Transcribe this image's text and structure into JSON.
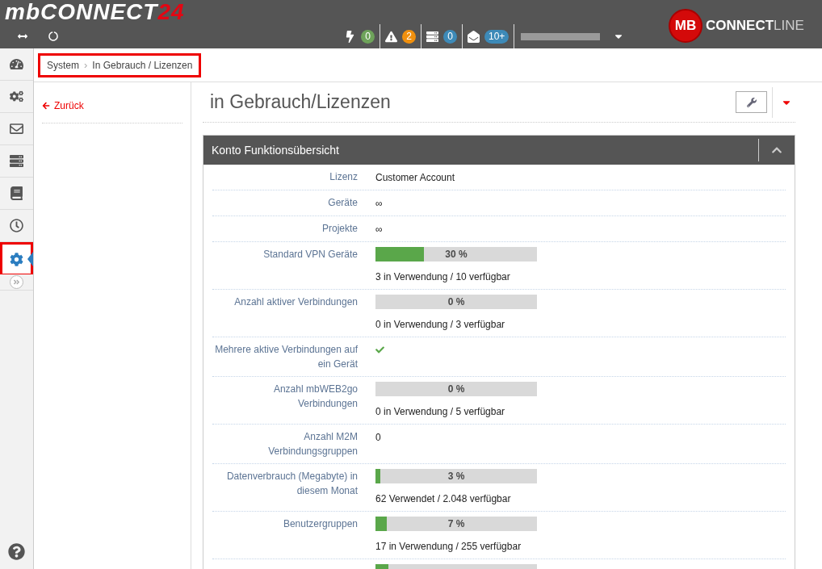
{
  "header": {
    "logo": {
      "main": "mbCONNECT",
      "accent": "24"
    },
    "brand": {
      "badge": "MB",
      "bold": "CONNECT",
      "light": "LINE"
    },
    "notifications": [
      {
        "kind": "bolt",
        "count": "0",
        "color": "#6ea35a"
      },
      {
        "kind": "warning",
        "count": "2",
        "color": "#f0900e"
      },
      {
        "kind": "server",
        "count": "0",
        "color": "#3d8ab8"
      },
      {
        "kind": "mail",
        "count": "10+",
        "color": "#3d8ab8"
      }
    ]
  },
  "breadcrumb": {
    "highlighted": true,
    "separator": "›",
    "items": [
      "System",
      "In Gebrauch / Lizenzen"
    ]
  },
  "sidebar": {
    "items": [
      {
        "kind": "gauge",
        "selected": false
      },
      {
        "kind": "cogs",
        "selected": false
      },
      {
        "kind": "mail",
        "selected": false
      },
      {
        "kind": "server",
        "selected": false
      },
      {
        "kind": "book",
        "selected": false
      },
      {
        "kind": "clock",
        "selected": false
      },
      {
        "kind": "settings",
        "selected": true
      }
    ]
  },
  "back_link": "Zurück",
  "page_title": "in Gebrauch/Lizenzen",
  "panel": {
    "title": "Konto Funktionsübersicht",
    "expanded": true,
    "rows": [
      {
        "kind": "text",
        "label": "Lizenz",
        "value": "Customer Account"
      },
      {
        "kind": "text",
        "label": "Geräte",
        "value": "∞"
      },
      {
        "kind": "text",
        "label": "Projekte",
        "value": "∞"
      },
      {
        "kind": "progress",
        "label": "Standard VPN Geräte",
        "level": 0.3,
        "percent": "30 %",
        "detail": "3 in Verwendung / 10 verfügbar"
      },
      {
        "kind": "progress",
        "label": "Anzahl aktiver Verbindungen",
        "level": 0,
        "percent": "0 %",
        "detail": "0 in Verwendung / 3 verfügbar"
      },
      {
        "kind": "check",
        "label": "Mehrere aktive Verbindungen auf ein Gerät",
        "checked": true
      },
      {
        "kind": "progress",
        "label": "Anzahl mbWEB2go Verbindungen",
        "level": 0,
        "percent": "0 %",
        "detail": "0 in Verwendung / 5 verfügbar"
      },
      {
        "kind": "text",
        "label": "Anzahl M2M Verbindungsgruppen",
        "value": "0"
      },
      {
        "kind": "progress",
        "label": "Datenverbrauch (Megabyte) in diesem Monat",
        "level": 0.03,
        "percent": "3 %",
        "detail": "62 Verwendet / 2.048 verfügbar"
      },
      {
        "kind": "progress",
        "label": "Benutzergruppen",
        "level": 0.07,
        "percent": "7 %",
        "detail": "17 in Verwendung / 255 verfügbar"
      },
      {
        "kind": "progress",
        "level": 0.08
      }
    ]
  }
}
